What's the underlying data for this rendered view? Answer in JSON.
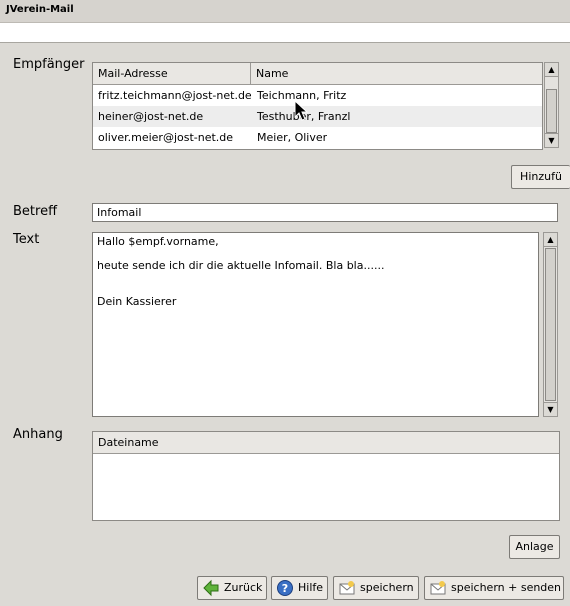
{
  "window": {
    "title": "JVerein-Mail"
  },
  "recipients": {
    "label": "Empfänger",
    "columns": [
      "Mail-Adresse",
      "Name"
    ],
    "rows": [
      {
        "email": "fritz.teichmann@jost-net.de",
        "name": "Teichmann, Fritz"
      },
      {
        "email": "heiner@jost-net.de",
        "name": "Testhuber, Franzl"
      },
      {
        "email": "oliver.meier@jost-net.de",
        "name": "Meier, Oliver"
      }
    ],
    "add_button": "Hinzufü"
  },
  "subject": {
    "label": "Betreff",
    "value": "Infomail"
  },
  "text": {
    "label": "Text",
    "value": "Hallo $empf.vorname,\n\nheute sende ich dir die aktuelle Infomail. Bla bla......\n\n\nDein Kassierer"
  },
  "attachments": {
    "label": "Anhang",
    "columns": [
      "Dateiname"
    ],
    "add_button": "Anlage"
  },
  "footer": {
    "back": "Zurück",
    "help": "Hilfe",
    "save": "speichern",
    "save_send": "speichern + senden"
  }
}
